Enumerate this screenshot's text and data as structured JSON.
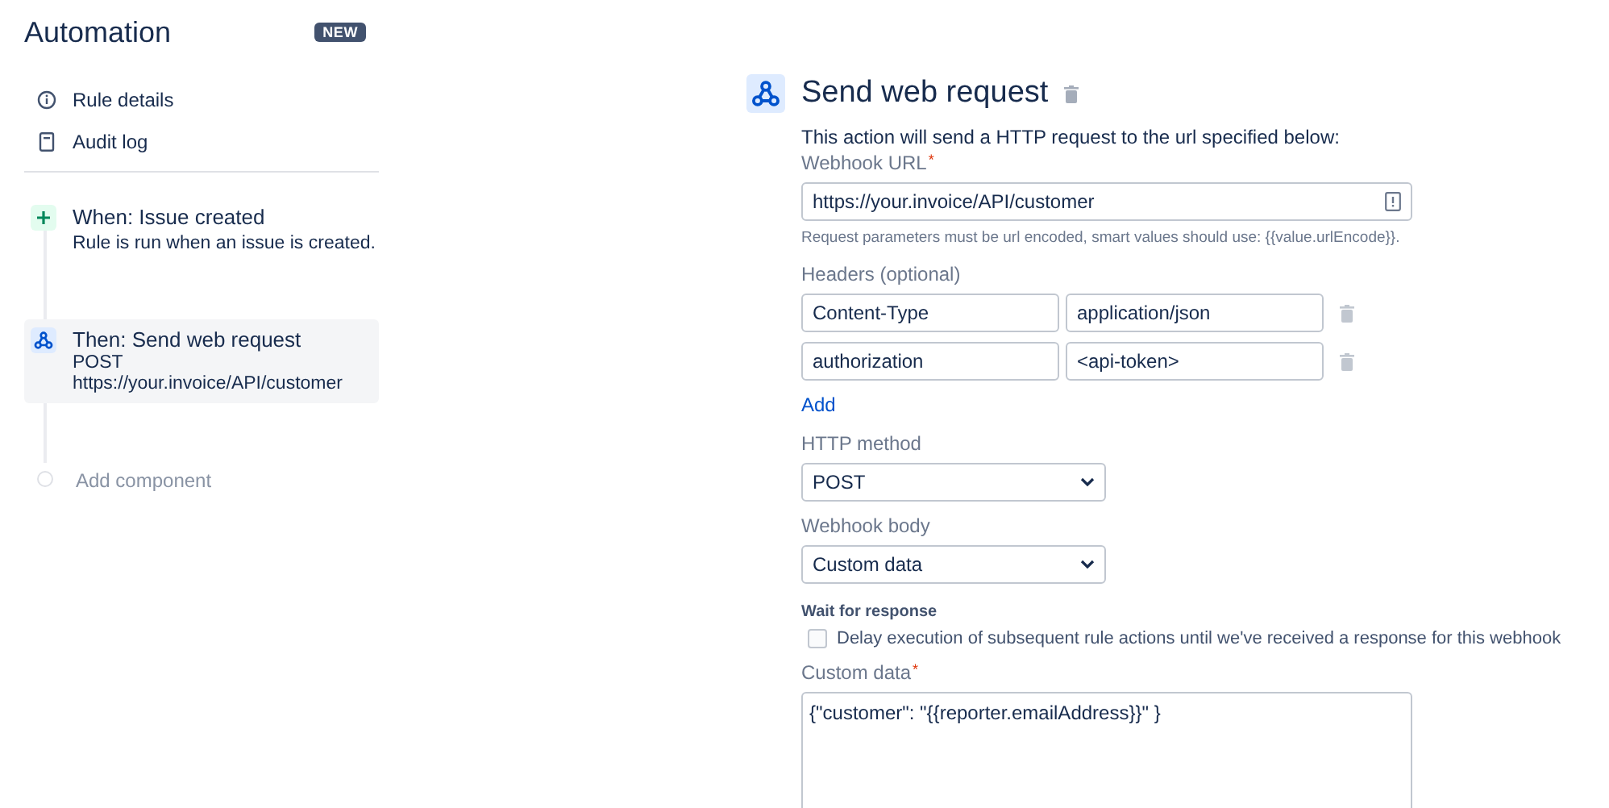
{
  "sidebar": {
    "title": "Automation",
    "badge": "NEW",
    "nav": [
      {
        "kind": "info",
        "label": "Rule details"
      },
      {
        "kind": "log",
        "label": "Audit log"
      }
    ],
    "steps": [
      {
        "kind": "trigger",
        "title": "When: Issue created",
        "lines": [
          "Rule is run when an issue is created."
        ],
        "selected": false
      },
      {
        "kind": "action",
        "title": "Then: Send web request",
        "lines": [
          "POST",
          "https://your.invoice/API/customer"
        ],
        "selected": true
      },
      {
        "kind": "add",
        "title": "Add component",
        "selected": false
      }
    ]
  },
  "panel": {
    "title": "Send web request",
    "description": "This action will send a HTTP request to the url specified below:",
    "url": {
      "label": "Webhook URL",
      "required_mark": "*",
      "value": "https://your.invoice/API/customer"
    },
    "url_hint": "Request parameters must be url encoded, smart values should use: {{value.urlEncode}}.",
    "headers": {
      "label": "Headers (optional)",
      "rows": [
        {
          "name": "Content-Type",
          "value": "application/json"
        },
        {
          "name": "authorization",
          "value": "<api-token>"
        }
      ],
      "add": "Add"
    },
    "method": {
      "label": "HTTP method",
      "value": "POST"
    },
    "body": {
      "label": "Webhook body",
      "value": "Custom data"
    },
    "wait": {
      "label": "Wait for response",
      "option": "Delay execution of subsequent rule actions until we've received a response for this webhook",
      "checked": false
    },
    "custom": {
      "label": "Custom data",
      "required_mark": "*",
      "value": "{\"customer\": \"{{reporter.emailAddress}}\" }"
    }
  }
}
